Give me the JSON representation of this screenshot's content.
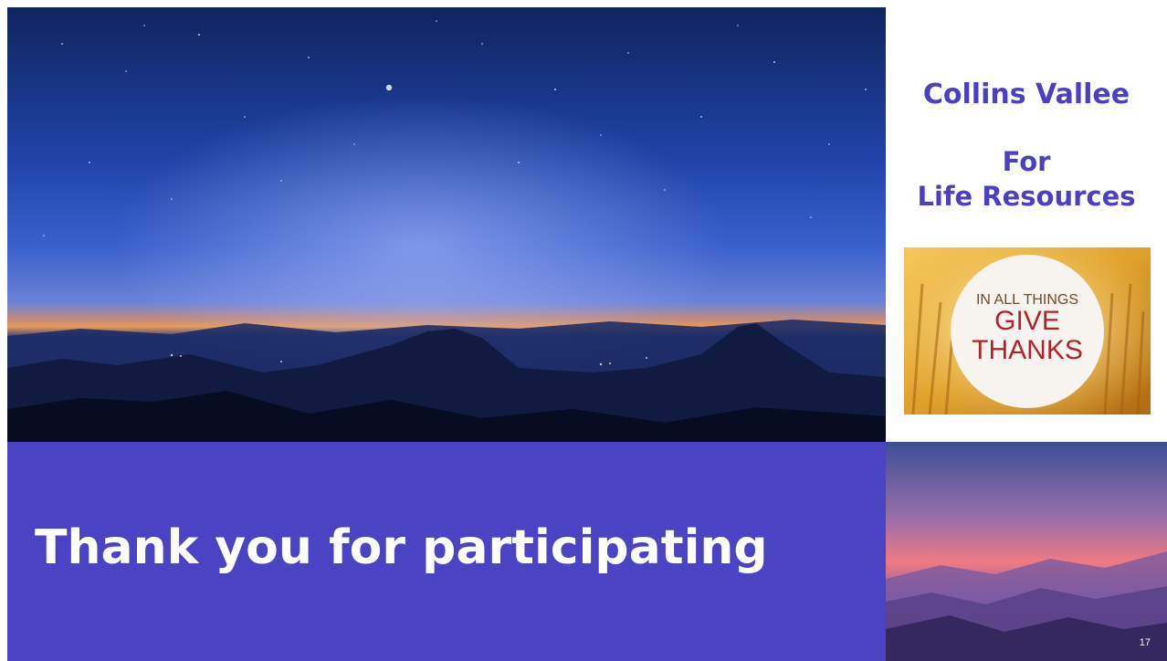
{
  "slide": {
    "org_name": "Collins Vallee",
    "for_line": "For",
    "resources_line": "Life Resources",
    "title": "Thank you for participating",
    "page_number": "17"
  },
  "thanks_image": {
    "line1": "IN ALL THINGS",
    "line2": "GIVE",
    "line3": "THANKS"
  },
  "colors": {
    "accent": "#4b3fc4",
    "banner": "#4a43c4"
  }
}
